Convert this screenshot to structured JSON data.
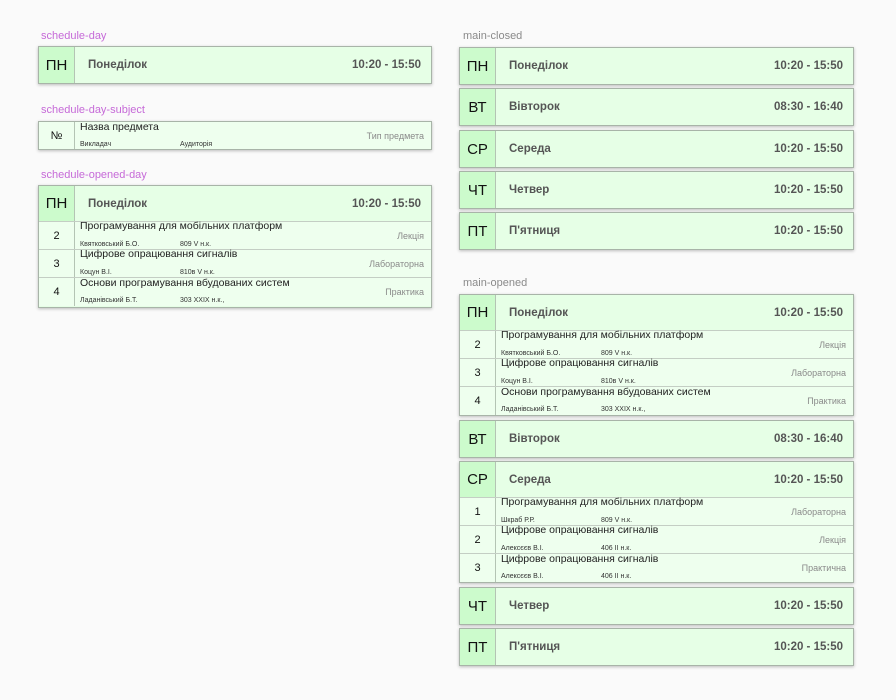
{
  "labels": {
    "schedule_day": "schedule-day",
    "schedule_day_subject": "schedule-day-subject",
    "schedule_opened_day": "schedule-opened-day",
    "main_closed": "main-closed",
    "main_opened": "main-opened"
  },
  "colors": {
    "card_bg": "#e6ffe6",
    "abbr_bg": "#ccfbcc",
    "label_pink": "#c66ad8",
    "label_gray": "#8a8a8a"
  },
  "schedule_day": {
    "abbr": "ПН",
    "name": "Понеділок",
    "time": "10:20 - 15:50"
  },
  "schedule_day_subject": {
    "num": "№",
    "title": "Назва предмета",
    "teacher": "Викладач",
    "room": "Аудиторія",
    "type": "Тип предмета"
  },
  "schedule_opened_day": {
    "abbr": "ПН",
    "name": "Понеділок",
    "time": "10:20 - 15:50",
    "subjects": [
      {
        "num": "2",
        "title": "Програмування для мобільних платформ",
        "teacher": "Квятковський Б.О.",
        "room": "809 V н.к.",
        "type": "Лекція"
      },
      {
        "num": "3",
        "title": "Цифрове опрацювання сигналів",
        "teacher": "Коцун В.І.",
        "room": "810в V н.к.",
        "type": "Лабораторна"
      },
      {
        "num": "4",
        "title": "Основи програмування вбудованих систем",
        "teacher": "Ладанівський Б.Т.",
        "room": "303 XXIX н.к.,",
        "type": "Практика"
      }
    ]
  },
  "main_closed": [
    {
      "abbr": "ПН",
      "name": "Понеділок",
      "time": "10:20 - 15:50"
    },
    {
      "abbr": "ВТ",
      "name": "Вівторок",
      "time": "08:30 - 16:40"
    },
    {
      "abbr": "СР",
      "name": "Середа",
      "time": "10:20 - 15:50"
    },
    {
      "abbr": "ЧТ",
      "name": "Четвер",
      "time": "10:20 - 15:50"
    },
    {
      "abbr": "ПТ",
      "name": "П'ятниця",
      "time": "10:20 - 15:50"
    }
  ],
  "main_opened": {
    "monday": {
      "abbr": "ПН",
      "name": "Понеділок",
      "time": "10:20 - 15:50",
      "subjects": [
        {
          "num": "2",
          "title": "Програмування для мобільних платформ",
          "teacher": "Квятковський Б.О.",
          "room": "809 V н.к.",
          "type": "Лекція"
        },
        {
          "num": "3",
          "title": "Цифрове опрацювання сигналів",
          "teacher": "Коцун В.І.",
          "room": "810в V н.к.",
          "type": "Лабораторна"
        },
        {
          "num": "4",
          "title": "Основи програмування вбудованих систем",
          "teacher": "Ладанівський Б.Т.",
          "room": "303 XXIX н.к.,",
          "type": "Практика"
        }
      ]
    },
    "tuesday": {
      "abbr": "ВТ",
      "name": "Вівторок",
      "time": "08:30 - 16:40"
    },
    "wednesday": {
      "abbr": "СР",
      "name": "Середа",
      "time": "10:20 - 15:50",
      "subjects": [
        {
          "num": "1",
          "title": "Програмування для мобільних платформ",
          "teacher": "Шкраб Р.Р.",
          "room": "809 V н.к.",
          "type": "Лабораторна"
        },
        {
          "num": "2",
          "title": "Цифрове опрацювання сигналів",
          "teacher": "Алексєєв В.І.",
          "room": "406 II н.к.",
          "type": "Лекція"
        },
        {
          "num": "3",
          "title": "Цифрове опрацювання сигналів",
          "teacher": "Алексєєв В.І.",
          "room": "406 II н.к.",
          "type": "Практична"
        }
      ]
    },
    "thursday": {
      "abbr": "ЧТ",
      "name": "Четвер",
      "time": "10:20 - 15:50"
    },
    "friday": {
      "abbr": "ПТ",
      "name": "П'ятниця",
      "time": "10:20 - 15:50"
    }
  }
}
